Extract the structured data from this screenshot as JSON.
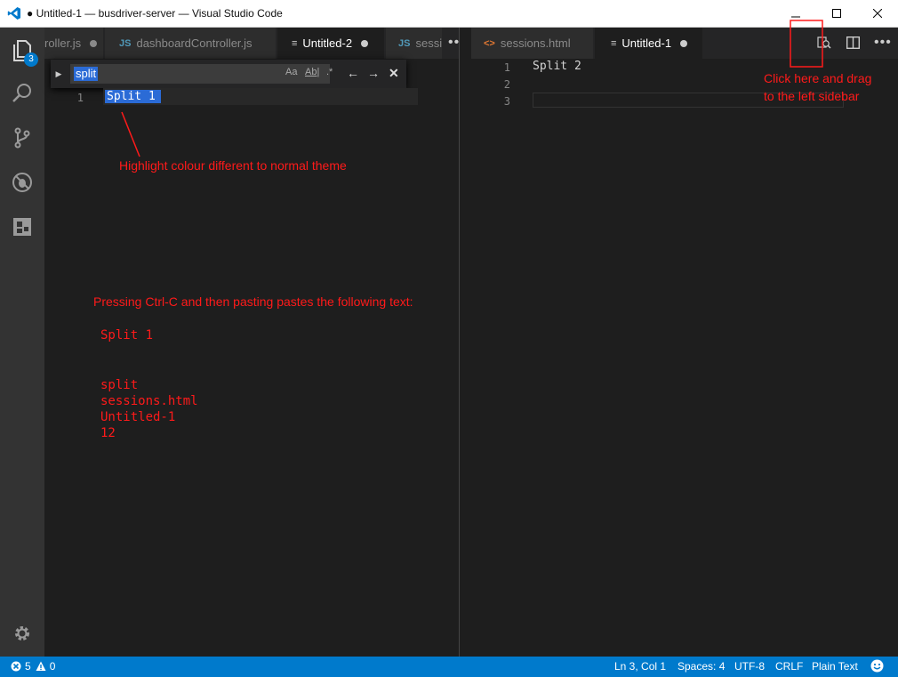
{
  "window": {
    "title": "● Untitled-1 — busdriver-server — Visual Studio Code"
  },
  "activity": {
    "explorer_badge": "3",
    "icons": [
      "files-icon",
      "search-icon",
      "source-control-icon",
      "debug-icon",
      "extensions-icon",
      "settings-gear-icon"
    ]
  },
  "left_group": {
    "tabs": [
      {
        "icon": "",
        "label": "roller.js"
      },
      {
        "icon": "JS",
        "label": "dashboardController.js"
      },
      {
        "icon": "≡",
        "label": "Untitled-2"
      },
      {
        "icon": "JS",
        "label": "sessio"
      }
    ],
    "more": "•••",
    "find": {
      "query": "split",
      "opt_case": "Aa",
      "opt_word": "Ab|",
      "opt_regex": ".*",
      "prev": "←",
      "next": "→",
      "close": "✕"
    },
    "lines": [
      {
        "num": "1",
        "text": "Split 1"
      }
    ]
  },
  "right_group": {
    "tabs": [
      {
        "icon": "<>",
        "label": "sessions.html"
      },
      {
        "icon": "≡",
        "label": "Untitled-1"
      }
    ],
    "more": "•••",
    "lines": [
      {
        "num": "1",
        "text": "Split 2"
      },
      {
        "num": "2",
        "text": ""
      },
      {
        "num": "3",
        "text": ""
      }
    ]
  },
  "annotations": {
    "highlight": "Highlight colour different to normal theme",
    "drag_line1": "Click here and drag",
    "drag_line2": "to the left sidebar",
    "paste_intro": "Pressing Ctrl-C and then pasting pastes the following text:",
    "paste_text1": "Split 1",
    "paste_text2": "split\nsessions.html\nUntitled-1\n12"
  },
  "status": {
    "errors": "5",
    "warnings": "0",
    "position": "Ln 3, Col 1",
    "spaces": "Spaces: 4",
    "encoding": "UTF-8",
    "eol": "CRLF",
    "language": "Plain Text"
  },
  "colors": {
    "accent": "#007acc",
    "annotation": "#ff1a1a",
    "find_match": "#2b6bd6"
  }
}
